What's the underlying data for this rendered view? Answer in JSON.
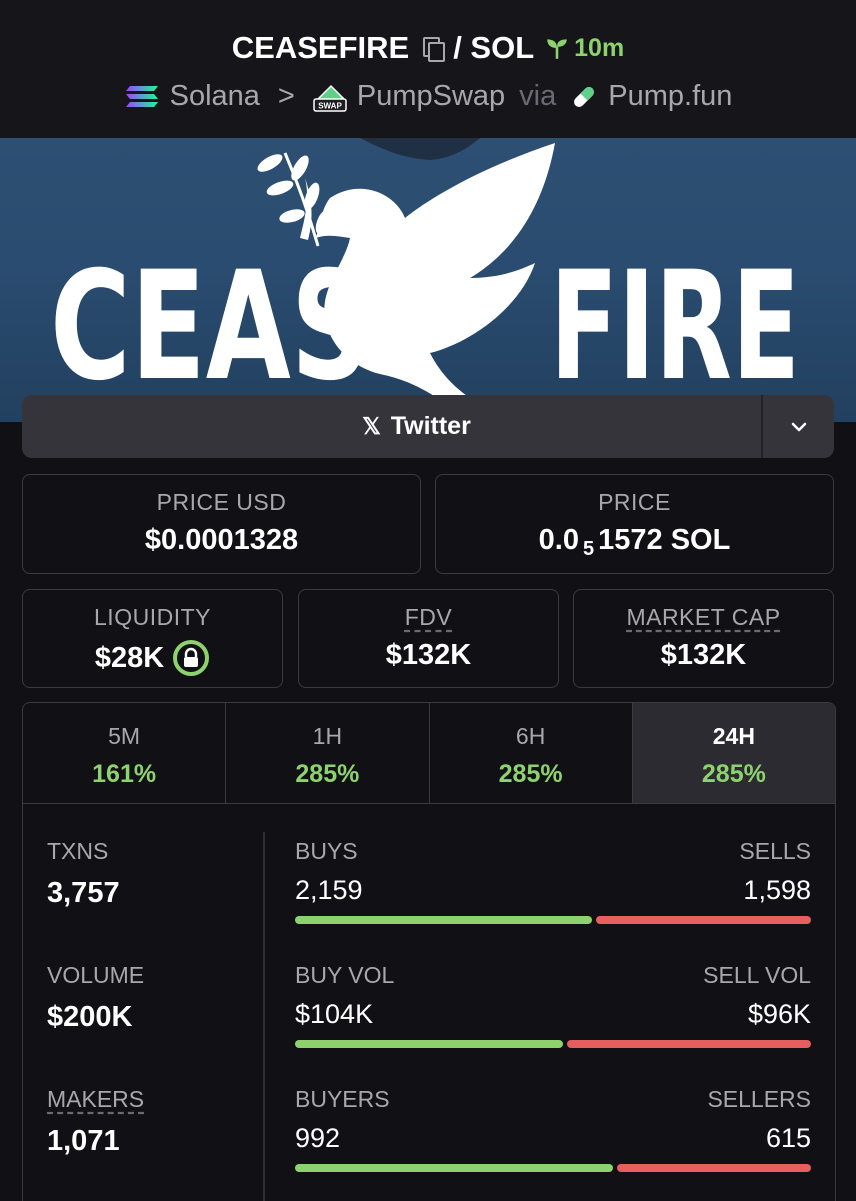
{
  "header": {
    "token": "CEASEFIRE",
    "pair": "/ SOL",
    "age": "10m",
    "chain": "Solana",
    "separator": ">",
    "dex": "PumpSwap",
    "via": "via",
    "launchpad": "Pump.fun",
    "swap_badge": "SWAP"
  },
  "banner": {
    "text_left": "CEAS",
    "text_right": "FIRE"
  },
  "social": {
    "twitter_label": "Twitter",
    "x_glyph": "𝕏"
  },
  "price_usd": {
    "label": "PRICE USD",
    "value": "$0.0001328"
  },
  "price_native": {
    "label": "PRICE",
    "prefix": "0.0",
    "zeros": "5",
    "suffix": "1572 SOL"
  },
  "liquidity": {
    "label": "LIQUIDITY",
    "value": "$28K"
  },
  "fdv": {
    "label": "FDV",
    "value": "$132K"
  },
  "market_cap": {
    "label": "MARKET CAP",
    "value": "$132K"
  },
  "tabs": [
    {
      "label": "5M",
      "change": "161%"
    },
    {
      "label": "1H",
      "change": "285%"
    },
    {
      "label": "6H",
      "change": "285%"
    },
    {
      "label": "24H",
      "change": "285%"
    }
  ],
  "selected_tab": "24H",
  "txns": {
    "label": "TXNS",
    "value": "3,757"
  },
  "volume": {
    "label": "VOLUME",
    "value": "$200K"
  },
  "makers": {
    "label": "MAKERS",
    "value": "1,071"
  },
  "buys_sells": {
    "left_label": "BUYS",
    "right_label": "SELLS",
    "left_value": "2,159",
    "right_value": "1,598",
    "buy_fraction": 0.575
  },
  "vol_split": {
    "left_label": "BUY VOL",
    "right_label": "SELL VOL",
    "left_value": "$104K",
    "right_value": "$96K",
    "buy_fraction": 0.52
  },
  "buyers_sellers": {
    "left_label": "BUYERS",
    "right_label": "SELLERS",
    "left_value": "992",
    "right_value": "615",
    "buy_fraction": 0.617
  },
  "colors": {
    "green": "#8ed16f",
    "red": "#e65e5e",
    "background": "#111115"
  }
}
